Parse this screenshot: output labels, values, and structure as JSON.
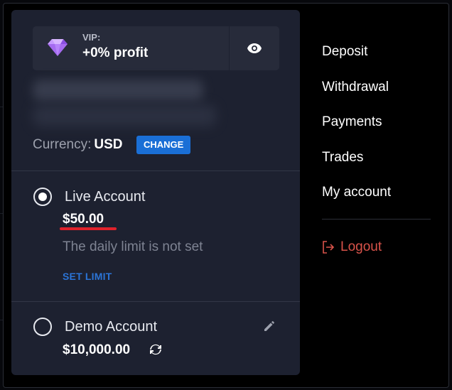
{
  "vip": {
    "label": "VIP:",
    "value": "+0% profit"
  },
  "currency": {
    "label": "Currency:",
    "code": "USD",
    "change_label": "CHANGE"
  },
  "live_account": {
    "name": "Live Account",
    "balance": "$50.00",
    "limit_text": "The daily limit is not set",
    "set_limit_label": "SET LIMIT",
    "selected": true
  },
  "demo_account": {
    "name": "Demo Account",
    "balance": "$10,000.00",
    "selected": false
  },
  "menu": {
    "items": [
      {
        "label": "Deposit"
      },
      {
        "label": "Withdrawal"
      },
      {
        "label": "Payments"
      },
      {
        "label": "Trades"
      },
      {
        "label": "My account"
      }
    ],
    "logout_label": "Logout"
  },
  "icons": {
    "vip": "diamond-icon",
    "visibility": "eye-icon",
    "edit": "pencil-icon",
    "refresh": "refresh-icon",
    "logout": "logout-icon"
  },
  "colors": {
    "accent": "#1a6fd6",
    "logout": "#d9534a",
    "gem": "#a66bf0",
    "underline": "#e0222b"
  }
}
